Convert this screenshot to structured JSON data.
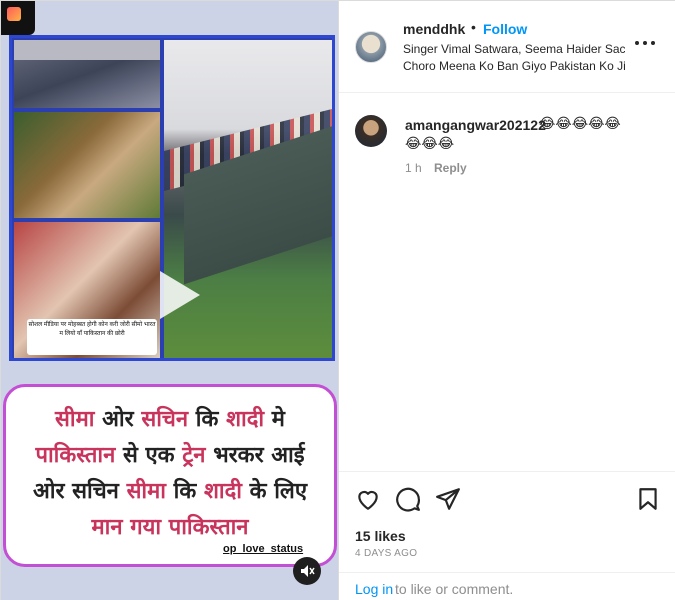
{
  "post": {
    "username": "menddhk",
    "separator": "•",
    "follow_label": "Follow",
    "subtitle_line1": "Singer Vimal Satwara, Seema Haider Sach",
    "subtitle_line2": "Choro Meena Ko Ban Giyo Pakistan Ko Jij"
  },
  "media": {
    "image_caption": "सोशल मीडिया पर मोहब्बत होगी कोन करी जोरी सीमो भारत म लियो याँ पाकिस्तान की छोरी",
    "text_line1_part1": "सीमा",
    "text_line1_part2": "ओर",
    "text_line1_part3": "सचिन",
    "text_line1_part4": "कि",
    "text_line1_part5": "शादी",
    "text_line1_part6": "मे",
    "text_line2_part1": "पाकिस्तान",
    "text_line2_part2": "से एक",
    "text_line2_part3": "ट्रेन",
    "text_line2_part4": "भरकर आई",
    "text_line3_part1": "ओर सचिन",
    "text_line3_part2": "सीमा",
    "text_line3_part3": "कि",
    "text_line3_part4": "शादी",
    "text_line3_part5": "के लिए",
    "text_line4_part1": "मान गया",
    "text_line4_part2": "पाकिस्तान",
    "status_tag": "op_love_status",
    "play_icon": "play-icon",
    "mute_icon": "muted-speaker-icon"
  },
  "comment": {
    "username": "amangangwar202122",
    "emojis_row1": "😂😂😂😂😂",
    "emojis_row2": "😂😂😂",
    "time": "1 h",
    "reply_label": "Reply"
  },
  "actions": {
    "like_icon": "heart-icon",
    "comment_icon": "comment-icon",
    "share_icon": "paper-plane-icon",
    "save_icon": "bookmark-icon",
    "likes": "15 likes",
    "date": "4 DAYS AGO",
    "login_link": "Log in",
    "login_rest": "to like or comment."
  },
  "colors": {
    "accent": "#0095f6",
    "card_border": "#c34fd4",
    "highlight_text": "#c8345c",
    "collage_border": "#2e47d1"
  }
}
